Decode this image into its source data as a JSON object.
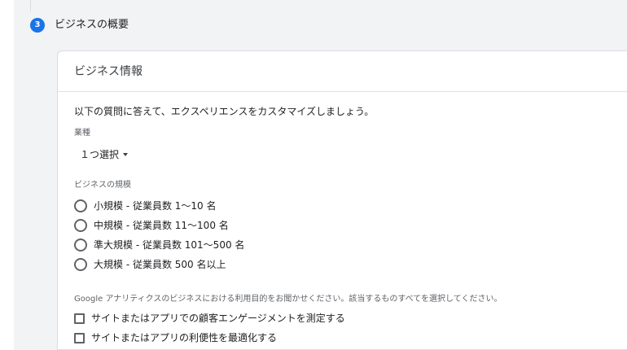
{
  "step": {
    "number": "3",
    "title": "ビジネスの概要"
  },
  "card": {
    "title": "ビジネス情報",
    "intro": "以下の質問に答えて、エクスペリエンスをカスタマイズしましょう。",
    "industry": {
      "label": "業種",
      "value": "１つ選択"
    },
    "business_size": {
      "label": "ビジネスの規模",
      "options": [
        {
          "label": "小規模 - 従業員数 1～10 名",
          "selected": false
        },
        {
          "label": "中規模 - 従業員数 11～100 名",
          "selected": false
        },
        {
          "label": "準大規模 - 従業員数 101～500 名",
          "selected": false
        },
        {
          "label": "大規模 - 従業員数 500 名以上",
          "selected": false
        }
      ]
    },
    "usage": {
      "question": "Google アナリティクスのビジネスにおける利用目的をお聞かせください。該当するものすべてを選択してください。",
      "options": [
        {
          "label": "サイトまたはアプリでの顧客エンゲージメントを測定する",
          "checked": false
        },
        {
          "label": "サイトまたはアプリの利便性を最適化する",
          "checked": false
        }
      ]
    }
  },
  "colors": {
    "accent": "#1a73e8",
    "panel_background": "#f1f3f4",
    "card_border": "#dadce0"
  }
}
